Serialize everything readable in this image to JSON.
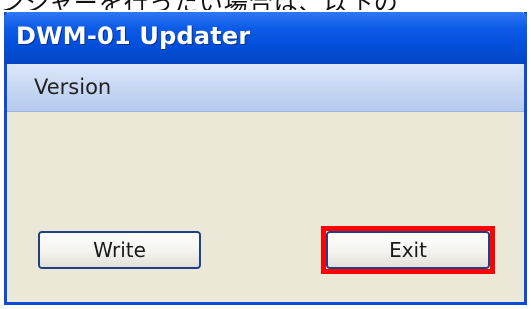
{
  "cut_off_text": "ンジャーを行ったい場合は、以下の",
  "window": {
    "title": "DWM-01 Updater",
    "version_label": "Version"
  },
  "buttons": {
    "write_label": "Write",
    "exit_label": "Exit"
  },
  "colors": {
    "title_bar": "#0450dc",
    "window_body": "#ece8d8",
    "version_bar": "#c8d8f3",
    "highlight": "#ff0000"
  }
}
